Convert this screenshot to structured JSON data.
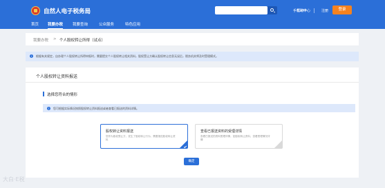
{
  "header": {
    "site_title": "自然人电子税务局",
    "top_links": [
      "手机APP",
      "帮助中心",
      "注册"
    ],
    "login_label": "登录"
  },
  "nav": {
    "items": [
      "首页",
      "我要办税",
      "我要查询",
      "公众服务",
      "特色应用"
    ]
  },
  "breadcrumb": {
    "parent": "我要办税",
    "separator": ">",
    "current": "个人股权转让所得（试点）"
  },
  "notice": {
    "text": "根据有关规定，自办理个人股权转让所得申报时，需要提交个人股权转让相关资料，股权受让方确认股权转让信息无误后，税务机关将及时受理模式。"
  },
  "panel": {
    "title": "个人股权转让资料报送",
    "section_title": "选择您符合的情形",
    "tip": "您可根据实际情况按照股权转让资料报送或者查看已报送的资料详情。",
    "options": [
      {
        "title": "股权转让资料报送",
        "desc": "您作为股权受让方，发生了股权转让行为，需要报送股权转让资料"
      },
      {
        "title": "查看已报送资料的受理详情",
        "desc": "查看已报送的资料受理详情，如股权转让资料，查看受理情况详情"
      }
    ],
    "confirm_label": "确定"
  },
  "watermark": "大白·E税",
  "colors": {
    "primary": "#2b6fd8",
    "login": "#f5821f",
    "notice_bg": "#dde8fb"
  }
}
